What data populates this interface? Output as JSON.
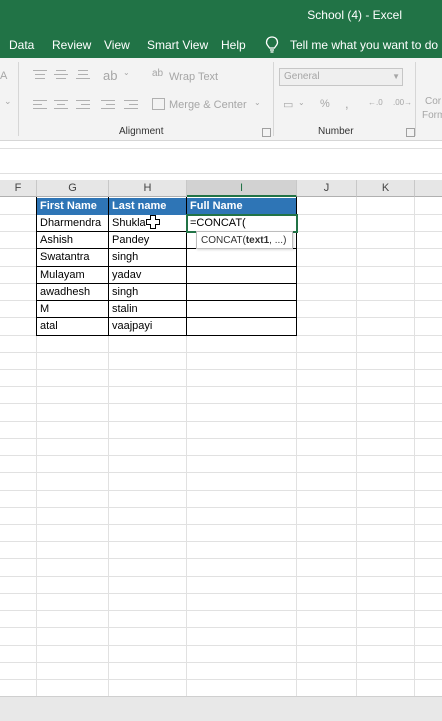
{
  "window": {
    "title": "School (4)  -  Excel"
  },
  "ribbon_tabs": [
    "Data",
    "Review",
    "View",
    "Smart View",
    "Help"
  ],
  "tell_me": "Tell me what you want to do",
  "alignment": {
    "wrap_text": "Wrap Text",
    "merge_center": "Merge & Center",
    "group_label": "Alignment"
  },
  "number": {
    "format_value": "General",
    "percent": "%",
    "comma": ",",
    "group_label": "Number",
    "cut_off_a": "Cor",
    "cut_off_b": "Form"
  },
  "columns": [
    "F",
    "G",
    "H",
    "I",
    "J",
    "K"
  ],
  "table": {
    "headers": [
      "First Name",
      "Last name",
      "Full Name"
    ],
    "rows": [
      [
        "Dharmendra",
        "Shukla",
        "=CONCAT("
      ],
      [
        "Ashish",
        "Pandey",
        ""
      ],
      [
        "Swatantra",
        "singh",
        ""
      ],
      [
        "Mulayam",
        "yadav",
        ""
      ],
      [
        "awadhesh",
        "singh",
        ""
      ],
      [
        "M",
        "stalin",
        ""
      ],
      [
        "atal",
        "vaajpayi",
        ""
      ]
    ]
  },
  "tooltip": {
    "prefix": "CONCAT(",
    "arg": "text1",
    "suffix": ", ...)"
  },
  "colors": {
    "excel_green": "#217346",
    "table_header": "#2e75b6"
  }
}
